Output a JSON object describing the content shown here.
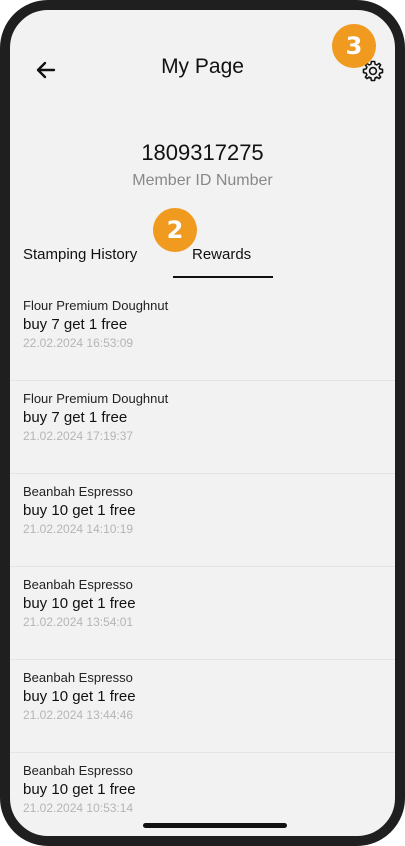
{
  "header": {
    "title": "My Page",
    "back_icon": "arrow-left-icon",
    "settings_icon": "gear-icon"
  },
  "badges": {
    "settings_badge": "3",
    "tab_badge": "2",
    "color": "#f09a20"
  },
  "member": {
    "id": "1809317275",
    "caption": "Member ID Number"
  },
  "tabs": [
    {
      "label": "Stamping History",
      "active": false
    },
    {
      "label": "Rewards",
      "active": true
    }
  ],
  "rewards": [
    {
      "shop": "Flour Premium Doughnut",
      "reward": "buy 7 get 1 free",
      "time": "22.02.2024 16:53:09"
    },
    {
      "shop": "Flour Premium Doughnut",
      "reward": "buy 7 get 1 free",
      "time": "21.02.2024 17:19:37"
    },
    {
      "shop": "Beanbah Espresso",
      "reward": "buy 10 get 1 free",
      "time": "21.02.2024 14:10:19"
    },
    {
      "shop": "Beanbah Espresso",
      "reward": "buy 10 get 1 free",
      "time": "21.02.2024 13:54:01"
    },
    {
      "shop": "Beanbah Espresso",
      "reward": "buy 10 get 1 free",
      "time": "21.02.2024 13:44:46"
    },
    {
      "shop": "Beanbah Espresso",
      "reward": "buy 10 get 1 free",
      "time": "21.02.2024 10:53:14"
    }
  ]
}
